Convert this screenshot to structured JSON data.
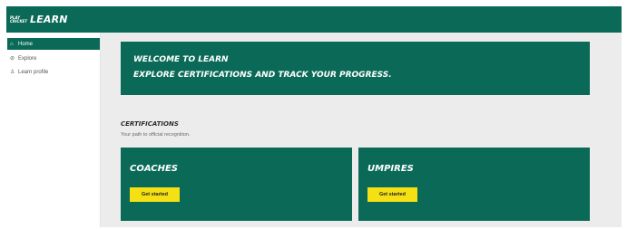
{
  "app": {
    "logo_lines": [
      "PLAY",
      "CRICKET"
    ],
    "title": "LEARN"
  },
  "sidebar": {
    "items": [
      {
        "label": "Home",
        "icon": "home-icon",
        "active": true
      },
      {
        "label": "Explore",
        "icon": "compass-icon",
        "active": false
      },
      {
        "label": "Learn profile",
        "icon": "profile-icon",
        "active": false
      }
    ]
  },
  "hero": {
    "line1": "Welcome to Learn",
    "line2": "Explore certifications and track your progress."
  },
  "certifications": {
    "title": "CERTIFICATIONS",
    "subtitle": "Your path to official recognition.",
    "cards": [
      {
        "title": "Coaches",
        "button": "Get started"
      },
      {
        "title": "Umpires",
        "button": "Get started"
      }
    ]
  },
  "colors": {
    "brand_green": "#0a6a57",
    "button_yellow": "#f5e014",
    "background": "#ececec"
  }
}
